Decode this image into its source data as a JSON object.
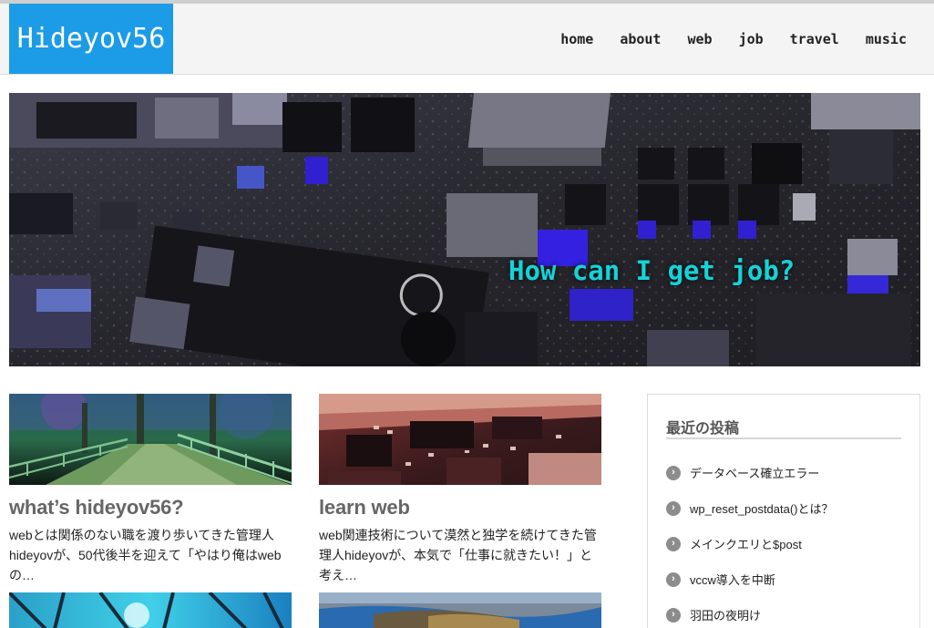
{
  "site": {
    "logo": "Hideyov56"
  },
  "nav": {
    "items": [
      "home",
      "about",
      "web",
      "job",
      "travel",
      "music"
    ]
  },
  "hero": {
    "caption": "How can I get job?"
  },
  "posts": [
    {
      "title": "what’s hideyov56?",
      "excerpt": "webとは関係のない職を渡り歩いてきた管理人hideyovが、50代後半を迎えて「やはり俺はwebの…"
    },
    {
      "title": "learn web",
      "excerpt": "web関連技術について漠然と独学を続けてきた管理人hideyovが、本気で「仕事に就きたい！」と考え…"
    }
  ],
  "sidebar": {
    "heading": "最近の投稿",
    "items": [
      "データベース確立エラー",
      "wp_reset_postdata()とは？",
      "メインクエリと$post",
      "vccw導入を中断",
      "羽田の夜明け"
    ],
    "bullet_icon": "chevron-right-icon"
  },
  "colors": {
    "brand": "#1c9be7",
    "hero_caption": "#15d3d8"
  }
}
